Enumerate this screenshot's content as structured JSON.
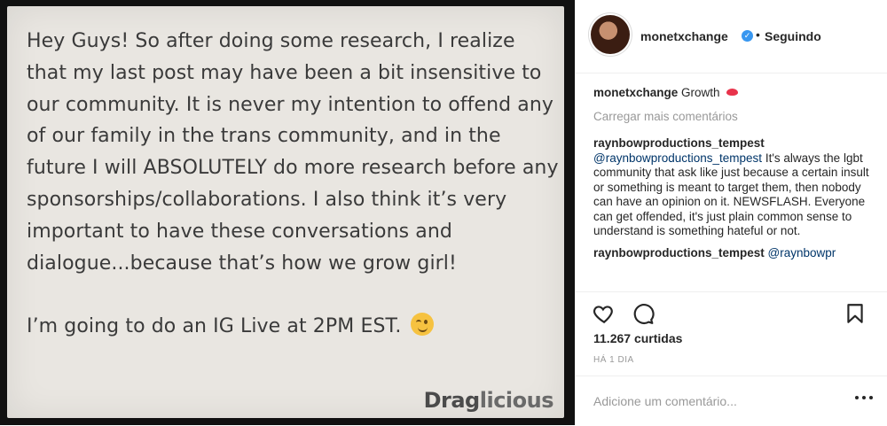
{
  "note": {
    "paragraph1": "Hey Guys! So after doing some research, I realize that my last post may have been a bit insensitive to our community. It is never my intention to offend any of our family in the trans community, and in the future I will ABSOLUTELY do more research before any sponsorships/collaborations. I also think it’s very important to have these conversations and dialogue...because that’s how we grow girl!",
    "paragraph2": "I’m going to do an IG Live at 2PM EST.",
    "watermark_a": "Drag",
    "watermark_b": "licious"
  },
  "header": {
    "username": "monetxchange",
    "separator": "•",
    "follow_label": "Seguindo"
  },
  "caption": {
    "username": "monetxchange",
    "text": "Growth"
  },
  "load_more": "Carregar mais comentários",
  "comments": [
    {
      "username": "raynbowproductions_tempest",
      "mention": "@raynbowproductions_tempest",
      "text": "It's always the lgbt community that ask like just because a certain insult or something is meant to target them, then nobody can have an opinion on it. NEWSFLASH. Everyone can get offended, it's just plain common sense to understand is something hateful or not."
    },
    {
      "username": "raynbowproductions_tempest",
      "mention": "@raynbowpr",
      "text": ""
    }
  ],
  "likes": "11.267 curtidas",
  "timestamp": "HÁ 1 DIA",
  "add_comment": {
    "placeholder": "Adicione um comentário..."
  }
}
